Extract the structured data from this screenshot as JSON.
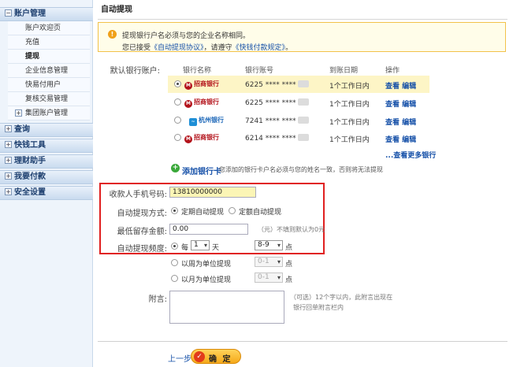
{
  "sidebar": {
    "account_mgmt": "账户管理",
    "items": [
      "账户欢迎页",
      "充值",
      "提现",
      "企业信息管理",
      "快易付用户",
      "复核交易管理",
      "集团账户管理"
    ],
    "sections": [
      "查询",
      "快钱工具",
      "理财助手",
      "我要付款",
      "安全设置"
    ]
  },
  "page_title": "自动提现",
  "notice": {
    "line1": "提现银行户名必须与您的企业名称相同。",
    "line2_prefix": "您已接受",
    "line2_link1": "《自动提现协议》",
    "line2_mid": "，请遵守",
    "line2_link2": "《快钱付款规定》",
    "line2_suffix": "。"
  },
  "default_bank_label": "默认银行账户:",
  "columns": {
    "bank": "银行名称",
    "account": "银行账号",
    "date": "到账日期",
    "ops": "操作"
  },
  "banks": [
    {
      "name": "招商银行",
      "account": "6225 **** ****",
      "date": "1个工作日内",
      "view": "查看",
      "edit": "编辑",
      "selected": true
    },
    {
      "name": "招商银行",
      "account": "6225 **** ****",
      "date": "1个工作日内",
      "view": "查看",
      "edit": "编辑",
      "selected": false
    },
    {
      "name": "杭州银行",
      "account": "7241 **** ****",
      "date": "1个工作日内",
      "view": "查看",
      "edit": "编辑",
      "selected": false
    },
    {
      "name": "招商银行",
      "account": "6214 **** ****",
      "date": "1个工作日内",
      "view": "查看",
      "edit": "编辑",
      "selected": false
    }
  ],
  "more_banks": "...查看更多银行",
  "add_bank": {
    "label": "添加银行卡",
    "hint": "您添加的银行卡户名必须与您的姓名一致，否则将无法提现"
  },
  "form": {
    "phone_label": "收款人手机号码:",
    "phone_value": "13810000000",
    "mode_label": "自动提现方式:",
    "mode_opt1": "定期自动提现",
    "mode_opt2": "定额自动提现",
    "min_label": "最低留存金额:",
    "min_value": "0.00",
    "min_hint": "（元）不填则默认为0元",
    "freq_label": "自动提现频度:",
    "freq_every": "每",
    "freq_num": "1",
    "freq_day": "天",
    "freq_time": "8-9",
    "point": "点",
    "week_label": "以周为单位提现",
    "week_time": "0-1",
    "month_label": "以月为单位提现",
    "month_time": "0-1",
    "note_label": "附言:",
    "note_hint1": "（可选）12个字以内，此附言出现在",
    "note_hint2": "银行回单附言栏内"
  },
  "footer": {
    "prev": "上一步",
    "confirm": "确 定"
  }
}
